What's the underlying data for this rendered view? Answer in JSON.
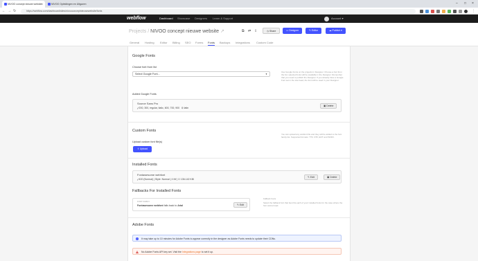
{
  "browser": {
    "tabs": [
      {
        "title": "NIVOO concept nieuwe website",
        "active": true
      },
      {
        "title": "NIVOO Opleidingen en Uitgave",
        "active": false
      }
    ],
    "url": "https://webflow.com/dashboard/sites/nivooconceptnieuwewebsite/fonts"
  },
  "webflow": {
    "logo": "webflow",
    "nav": [
      "Dashboard",
      "Showcase",
      "Designers",
      "Learn & Support"
    ],
    "account": "Account"
  },
  "project": {
    "crumb_prefix": "Projects",
    "crumb_sep": "/",
    "name": "NIVOO concept nieuwe website",
    "share": "Share",
    "designer": "Designer",
    "editor": "Editor",
    "publish": "Publish"
  },
  "tabs": [
    "General",
    "Hosting",
    "Editor",
    "Billing",
    "SEO",
    "Forms",
    "Fonts",
    "Backups",
    "Integrations",
    "Custom Code"
  ],
  "google": {
    "heading": "Google Fonts",
    "choose_label": "Choose font from list",
    "select_placeholder": "Select Google Font...",
    "help": "Use Google Fonts on the projects in Designer. Choose a font from the list; selected fonts will be available in the Designer. Remember that you need to publish the Designer. If you already have a Google Font set in the site head, the font will be used in your Designer.",
    "added_label": "Added Google Fonts",
    "font_name": "Source Sans Pro",
    "weights": "200, 300, regular, italic, 600, 700, 900",
    "subset": "latin",
    "delete": "Delete"
  },
  "custom": {
    "heading": "Custom Fonts",
    "upload_label": "Upload custom font file(s)",
    "upload_btn": "Upload",
    "help": "You can upload any webfont file and they will be added to the font family list. Supported formats: TTF, OTF, EOT and WOFF."
  },
  "installed": {
    "heading": "Installed Fonts",
    "font_name": "Fontawesome webfont",
    "weight": "400 (Normal)",
    "style": "Style: Normal",
    "type": "ttf",
    "size": "136.142 KiB",
    "edit": "Edit",
    "delete": "Delete"
  },
  "fallbacks": {
    "heading": "Fallbacks For Installed Fonts",
    "small_label": "FONT FAMILY",
    "font": "Fontawesome webfont",
    "falls_text": "falls back to",
    "fallback": "Arial",
    "edit": "Edit",
    "help_title": "Fallback Fonts",
    "help": "Select the fallback font that best fits each of your installed fonts for the case where the font cannot load."
  },
  "adobe": {
    "heading": "Adobe Fonts",
    "info": "It may take up to 10 minutes for Adobe Fonts to appear correctly in the designer as Adobe Fonts needs to update their CDNs.",
    "warn_prefix": "No Adobe Fonts API key set. Visit the",
    "warn_link": "Integrations page",
    "warn_suffix": "to set it up."
  },
  "colors": {
    "accent": "#4353ff",
    "link": "#e76f23"
  }
}
